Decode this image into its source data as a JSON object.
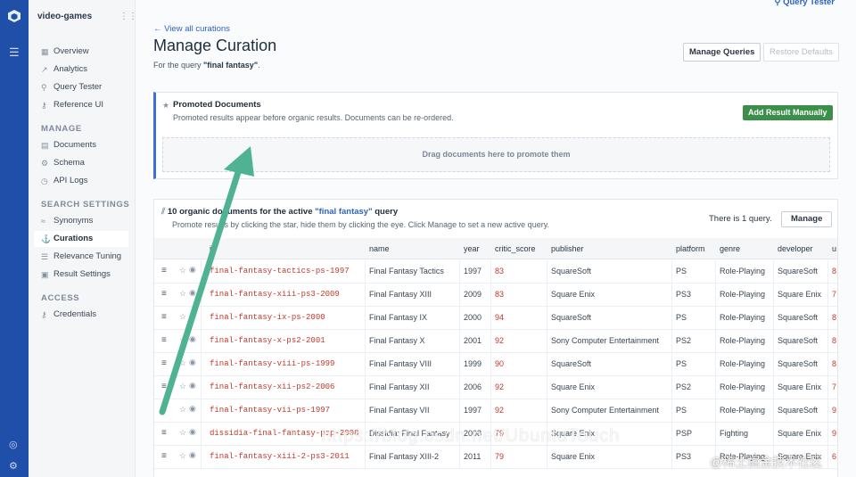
{
  "app": {
    "name": "video-games"
  },
  "sidebar": {
    "top_items": [
      {
        "label": "Overview",
        "icon": "overview-icon"
      },
      {
        "label": "Analytics",
        "icon": "analytics-icon"
      },
      {
        "label": "Query Tester",
        "icon": "query-tester-icon"
      },
      {
        "label": "Reference UI",
        "icon": "reference-ui-icon"
      }
    ],
    "manage_title": "MANAGE",
    "manage_items": [
      {
        "label": "Documents",
        "icon": "documents-icon"
      },
      {
        "label": "Schema",
        "icon": "schema-icon"
      },
      {
        "label": "API Logs",
        "icon": "api-logs-icon"
      }
    ],
    "search_title": "SEARCH SETTINGS",
    "search_items": [
      {
        "label": "Synonyms",
        "icon": "synonyms-icon"
      },
      {
        "label": "Curations",
        "icon": "curations-icon",
        "active": true
      },
      {
        "label": "Relevance Tuning",
        "icon": "relevance-icon"
      },
      {
        "label": "Result Settings",
        "icon": "result-settings-icon"
      }
    ],
    "access_title": "ACCESS",
    "access_items": [
      {
        "label": "Credentials",
        "icon": "credentials-icon"
      }
    ]
  },
  "header": {
    "query_tester_link": "Query Tester",
    "back_link": "View all curations",
    "title": "Manage Curation",
    "subtitle_prefix": "For the query ",
    "subtitle_query": "\"final fantasy\"",
    "subtitle_suffix": ".",
    "manage_queries": "Manage Queries",
    "restore_defaults": "Restore Defaults"
  },
  "promoted": {
    "title": "Promoted Documents",
    "description": "Promoted results appear before organic results. Documents can be re-ordered.",
    "add_button": "Add Result Manually",
    "dropzone_text": "Drag documents here to promote them"
  },
  "organic": {
    "heading_prefix": "10 organic documents for the active ",
    "heading_query": "\"final fantasy\"",
    "heading_suffix": " query",
    "description": "Promote results by clicking the star, hide them by clicking the eye. Click Manage to set a new active query.",
    "count_text": "There is 1 query.",
    "manage_button": "Manage",
    "columns": [
      "id",
      "name",
      "year",
      "critic_score",
      "publisher",
      "platform",
      "genre",
      "developer",
      "u"
    ],
    "rows": [
      [
        "final-fantasy-tactics-ps-1997",
        "Final Fantasy Tactics",
        "1997",
        "83",
        "SquareSoft",
        "PS",
        "Role-Playing",
        "SquareSoft",
        "8"
      ],
      [
        "final-fantasy-xiii-ps3-2009",
        "Final Fantasy XIII",
        "2009",
        "83",
        "Square Enix",
        "PS3",
        "Role-Playing",
        "Square Enix",
        "7"
      ],
      [
        "final-fantasy-ix-ps-2000",
        "Final Fantasy IX",
        "2000",
        "94",
        "SquareSoft",
        "PS",
        "Role-Playing",
        "SquareSoft",
        "8"
      ],
      [
        "final-fantasy-x-ps2-2001",
        "Final Fantasy X",
        "2001",
        "92",
        "Sony Computer Entertainment",
        "PS2",
        "Role-Playing",
        "SquareSoft",
        "8"
      ],
      [
        "final-fantasy-viii-ps-1999",
        "Final Fantasy VIII",
        "1999",
        "90",
        "SquareSoft",
        "PS",
        "Role-Playing",
        "SquareSoft",
        "8"
      ],
      [
        "final-fantasy-xii-ps2-2006",
        "Final Fantasy XII",
        "2006",
        "92",
        "Square Enix",
        "PS2",
        "Role-Playing",
        "Square Enix",
        "7"
      ],
      [
        "final-fantasy-vii-ps-1997",
        "Final Fantasy VII",
        "1997",
        "92",
        "Sony Computer Entertainment",
        "PS",
        "Role-Playing",
        "SquareSoft",
        "9"
      ],
      [
        "dissidia-final-fantasy-psp-2008",
        "Dissidia: Final Fantasy",
        "2008",
        "79",
        "Square Enix",
        "PSP",
        "Fighting",
        "Square Enix",
        "9"
      ],
      [
        "final-fantasy-xiii-2-ps3-2011",
        "Final Fantasy XIII-2",
        "2011",
        "79",
        "Square Enix",
        "PS3",
        "Role-Playing",
        "Square Enix",
        "6"
      ]
    ]
  },
  "watermark": {
    "url": "https://blog.csdn.net/UbuntuTouch",
    "brand": "@稀土掘金技术社区"
  },
  "colors": {
    "accent": "#2c63c7",
    "rail": "#1f4fa8",
    "green": "#3b8f4a",
    "id_red": "#c0392b",
    "arrow": "#4fb393"
  }
}
